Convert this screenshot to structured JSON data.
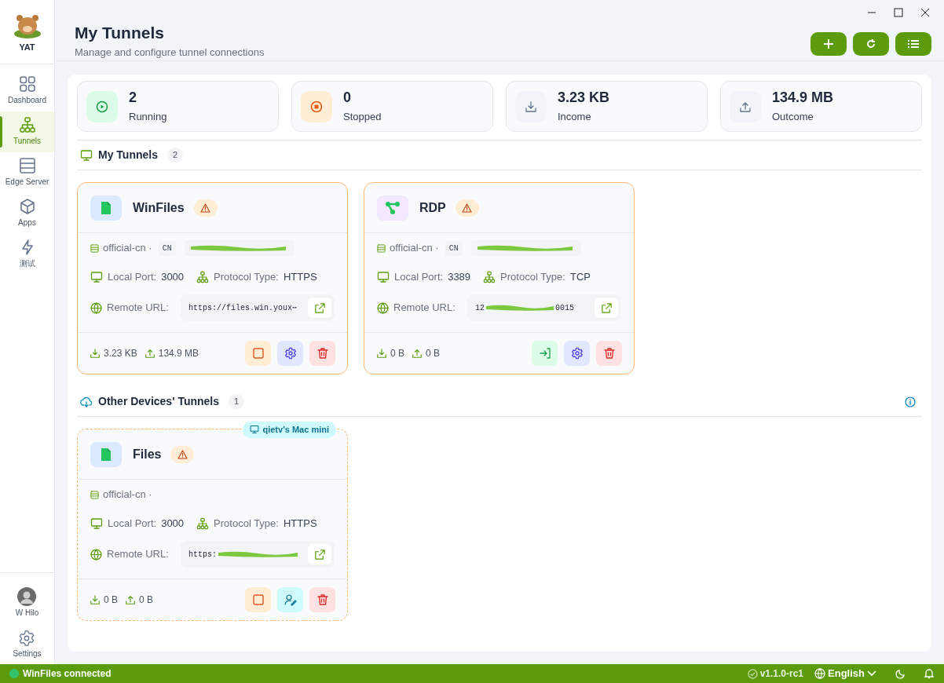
{
  "app": {
    "name": "YAT"
  },
  "sidebar": {
    "items": [
      {
        "label": "Dashboard",
        "selected": false
      },
      {
        "label": "Tunnels",
        "selected": true
      },
      {
        "label": "Edge Server",
        "selected": false
      },
      {
        "label": "Apps",
        "selected": false
      },
      {
        "label": "测试",
        "selected": false
      }
    ],
    "user": {
      "name": "W Hilo"
    },
    "settings": {
      "label": "Settings"
    }
  },
  "header": {
    "title": "My Tunnels",
    "subtitle": "Manage and configure tunnel connections"
  },
  "stats": [
    {
      "kind": "running",
      "value": "2",
      "label": "Running"
    },
    {
      "kind": "stopped",
      "value": "0",
      "label": "Stopped"
    },
    {
      "kind": "income",
      "value": "3.23 KB",
      "label": "Income"
    },
    {
      "kind": "outcome",
      "value": "134.9 MB",
      "label": "Outcome"
    }
  ],
  "sections": [
    {
      "kind": "mine",
      "title": "My Tunnels",
      "count": "2",
      "tunnels": [
        {
          "name": "WinFiles",
          "kind": "file",
          "warning": true,
          "server": "official-cn ·",
          "region": "CN",
          "redacted_ip": true,
          "local_port_label": "Local Port:",
          "local_port": "3000",
          "protocol_label": "Protocol Type:",
          "protocol": "HTTPS",
          "remote_label": "Remote URL:",
          "url_start": "https://files.win.youx⋯",
          "download": "3.23 KB",
          "upload": "134.9 MB",
          "actions": [
            {
              "kind": "stop"
            },
            {
              "kind": "settings"
            },
            {
              "kind": "delete"
            }
          ]
        },
        {
          "name": "RDP",
          "kind": "share",
          "warning": true,
          "server": "official-cn ·",
          "region": "CN",
          "redacted_ip": true,
          "local_port_label": "Local Port:",
          "local_port": "3389",
          "protocol_label": "Protocol Type:",
          "protocol": "TCP",
          "remote_label": "Remote URL:",
          "url_start": "12",
          "url_redacted": true,
          "url_end": "0015",
          "download": "0 B",
          "upload": "0 B",
          "actions": [
            {
              "kind": "connect"
            },
            {
              "kind": "settings"
            },
            {
              "kind": "delete"
            }
          ]
        }
      ]
    },
    {
      "kind": "others",
      "title": "Other Devices' Tunnels",
      "count": "1",
      "info": true,
      "tunnels": [
        {
          "name": "Files",
          "kind": "file",
          "warning": true,
          "device": "qietv's Mac mini",
          "server": "official-cn ·",
          "local_port_label": "Local Port:",
          "local_port": "3000",
          "protocol_label": "Protocol Type:",
          "protocol": "HTTPS",
          "remote_label": "Remote URL:",
          "url_start": "https:",
          "url_redacted": true,
          "download": "0 B",
          "upload": "0 B",
          "actions": [
            {
              "kind": "stop"
            },
            {
              "kind": "assign"
            },
            {
              "kind": "delete"
            }
          ]
        }
      ]
    }
  ],
  "status_bar": {
    "message": "WinFiles connected",
    "connected": true,
    "version": "v1.1.0-rc1",
    "language": "English"
  }
}
